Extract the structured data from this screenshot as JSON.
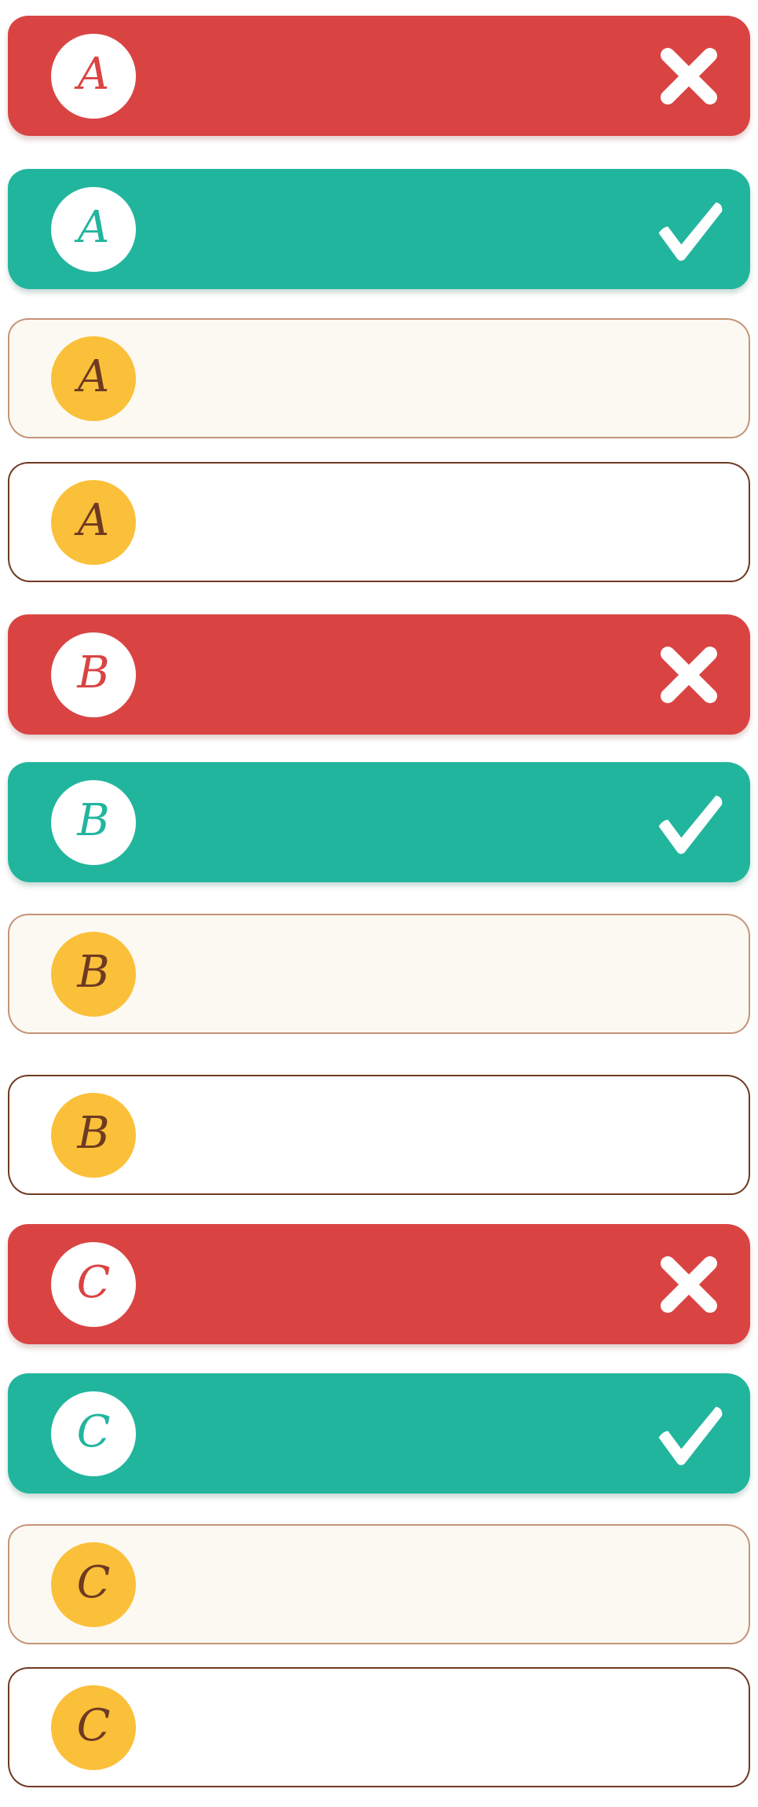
{
  "groups": [
    {
      "letter": "A",
      "states": [
        {
          "state": "wrong",
          "icon": "x-icon"
        },
        {
          "state": "correct",
          "icon": "check-icon"
        },
        {
          "state": "hover",
          "icon": ""
        },
        {
          "state": "default",
          "icon": ""
        }
      ]
    },
    {
      "letter": "B",
      "states": [
        {
          "state": "wrong",
          "icon": "x-icon"
        },
        {
          "state": "correct",
          "icon": "check-icon"
        },
        {
          "state": "hover",
          "icon": ""
        },
        {
          "state": "default",
          "icon": ""
        }
      ]
    },
    {
      "letter": "C",
      "states": [
        {
          "state": "wrong",
          "icon": "x-icon"
        },
        {
          "state": "correct",
          "icon": "check-icon"
        },
        {
          "state": "hover",
          "icon": ""
        },
        {
          "state": "default",
          "icon": ""
        }
      ]
    }
  ],
  "colors": {
    "wrong": "#d94443",
    "correct": "#22b59e",
    "hover_bg": "#fcf9f3",
    "hover_border": "#c59476",
    "default_border": "#6e3a22",
    "badge_yellow": "#fbc03a",
    "letter_brown": "#6e3a22"
  }
}
